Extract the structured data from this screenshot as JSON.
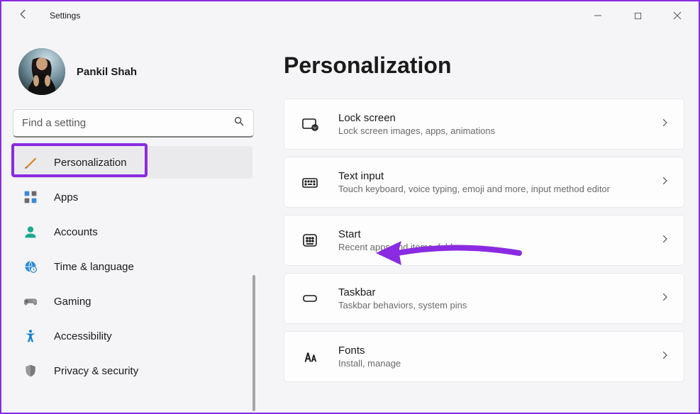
{
  "app_title": "Settings",
  "user_name": "Pankil Shah",
  "search": {
    "placeholder": "Find a setting"
  },
  "sidebar": {
    "items": [
      {
        "label": "Personalization"
      },
      {
        "label": "Apps"
      },
      {
        "label": "Accounts"
      },
      {
        "label": "Time & language"
      },
      {
        "label": "Gaming"
      },
      {
        "label": "Accessibility"
      },
      {
        "label": "Privacy & security"
      }
    ]
  },
  "page": {
    "title": "Personalization",
    "cards": [
      {
        "title": "Lock screen",
        "desc": "Lock screen images, apps, animations"
      },
      {
        "title": "Text input",
        "desc": "Touch keyboard, voice typing, emoji and more, input method editor"
      },
      {
        "title": "Start",
        "desc": "Recent apps and items, folders"
      },
      {
        "title": "Taskbar",
        "desc": "Taskbar behaviors, system pins"
      },
      {
        "title": "Fonts",
        "desc": "Install, manage"
      }
    ]
  }
}
